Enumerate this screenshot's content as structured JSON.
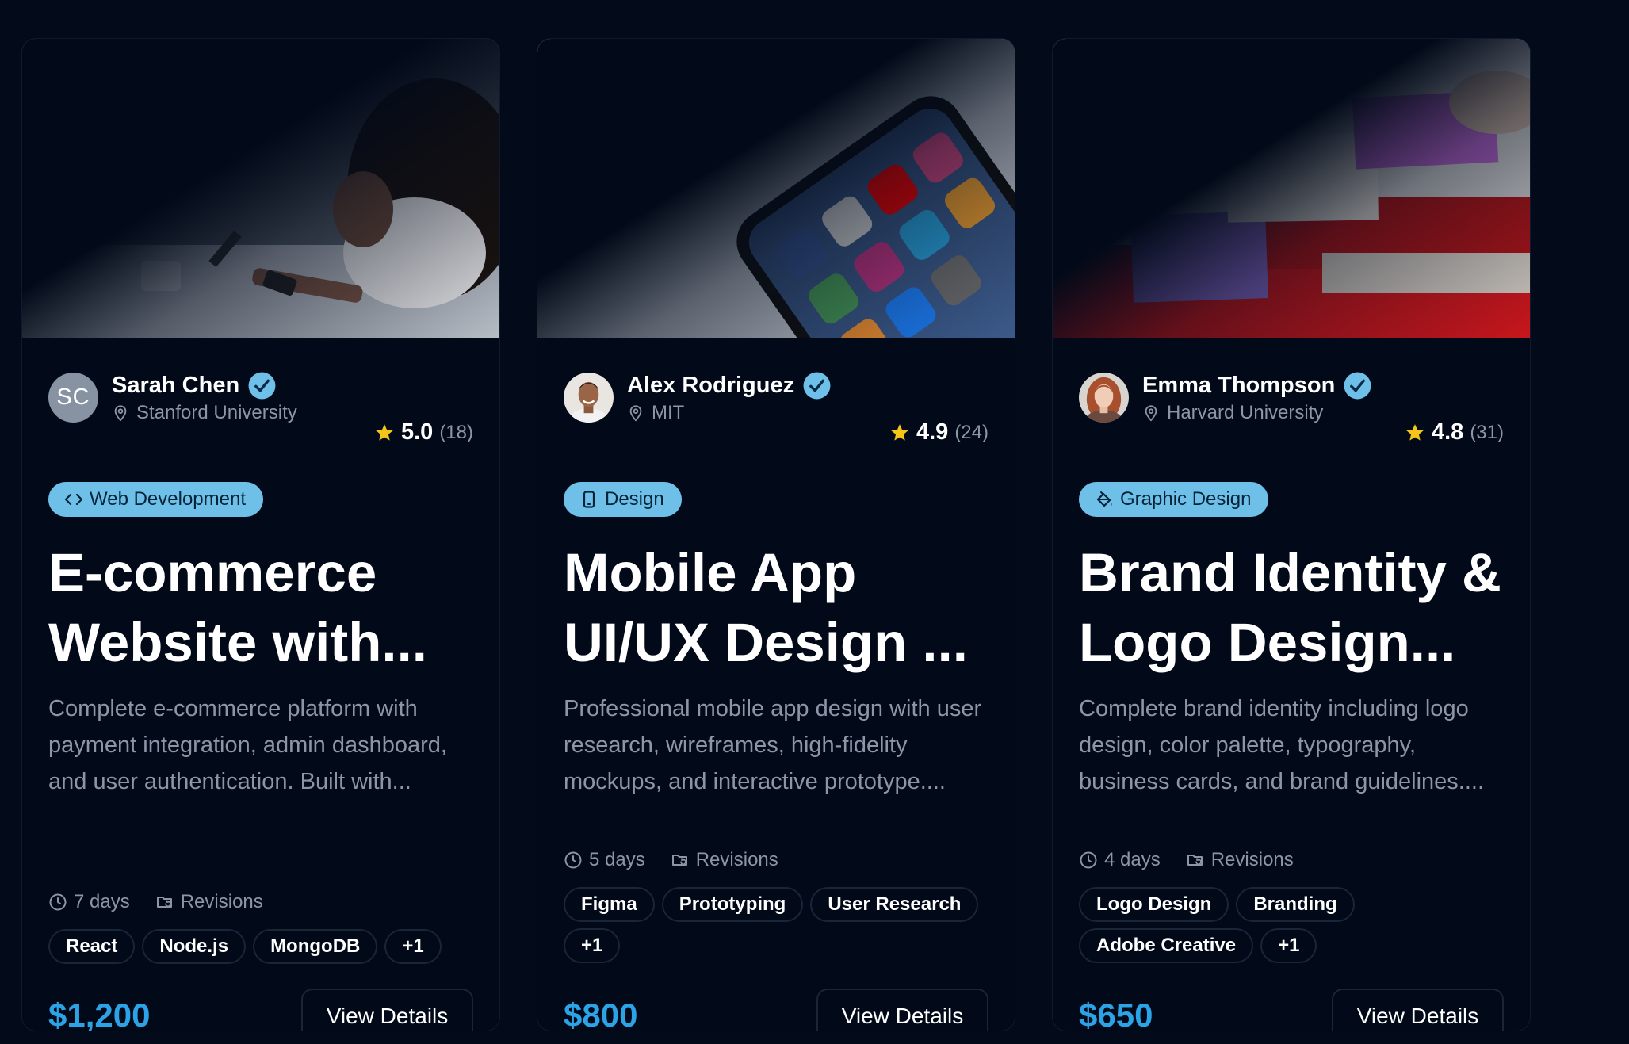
{
  "projects": [
    {
      "author": {
        "name": "Sarah Chen",
        "initials": "SC",
        "university": "Stanford University"
      },
      "rating": {
        "value": "5.0",
        "count": "(18)"
      },
      "category": {
        "label": "Web Development",
        "icon": "code-icon"
      },
      "title": "E-commerce Website with...",
      "description": "Complete e-commerce platform with payment integration, admin dashboard, and user authentication. Built with...",
      "duration": "7 days",
      "revisions": "Revisions",
      "tags": [
        "React",
        "Node.js",
        "MongoDB",
        "+1"
      ],
      "price": "$1,200",
      "button": "View Details"
    },
    {
      "author": {
        "name": "Alex Rodriguez",
        "initials": "",
        "university": "MIT"
      },
      "rating": {
        "value": "4.9",
        "count": "(24)"
      },
      "category": {
        "label": "Design",
        "icon": "smartphone-icon"
      },
      "title": "Mobile App UI/UX Design ...",
      "description": "Professional mobile app design with user research, wireframes, high-fidelity mockups, and interactive prototype....",
      "duration": "5 days",
      "revisions": "Revisions",
      "tags": [
        "Figma",
        "Prototyping",
        "User Research",
        "+1"
      ],
      "price": "$800",
      "button": "View Details"
    },
    {
      "author": {
        "name": "Emma Thompson",
        "initials": "",
        "university": "Harvard University"
      },
      "rating": {
        "value": "4.8",
        "count": "(31)"
      },
      "category": {
        "label": "Graphic Design",
        "icon": "paint-bucket-icon"
      },
      "title": "Brand Identity & Logo Design...",
      "description": "Complete brand identity including logo design, color palette, typography, business cards, and brand guidelines....",
      "duration": "4 days",
      "revisions": "Revisions",
      "tags": [
        "Logo Design",
        "Branding",
        "Adobe Creative",
        "+1"
      ],
      "price": "$650",
      "button": "View Details"
    }
  ],
  "colors": {
    "background": "#030b1a",
    "accent": "#2ba3e6",
    "badge": "#6fc0e8",
    "star": "#f5c518",
    "muted": "#8d96a6"
  }
}
